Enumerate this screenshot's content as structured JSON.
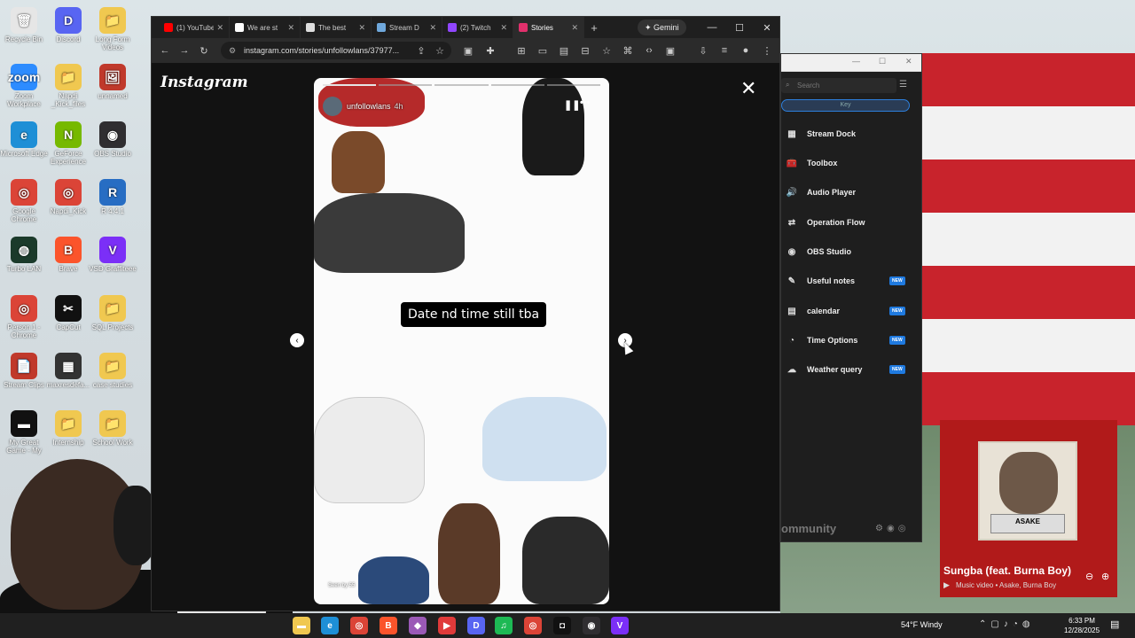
{
  "desktop": {
    "icons": [
      {
        "label": "Recycle Bin",
        "glyph": "🗑",
        "color": "#e6e6e6"
      },
      {
        "label": "Discord",
        "glyph": "D",
        "color": "#5865f2"
      },
      {
        "label": "Long Form Videos",
        "glyph": "📁",
        "color": "#f0c850"
      },
      {
        "label": "Zoom Workplace",
        "glyph": "zoom",
        "color": "#2d8cff"
      },
      {
        "label": "Napdi _Kick_files",
        "glyph": "📁",
        "color": "#f0c850"
      },
      {
        "label": "unnamed",
        "glyph": "🖼",
        "color": "#c0392b"
      },
      {
        "label": "Microsoft Edge",
        "glyph": "e",
        "color": "#1e8fd6"
      },
      {
        "label": "GeForce Experience",
        "glyph": "N",
        "color": "#76b900"
      },
      {
        "label": "OBS Studio",
        "glyph": "◉",
        "color": "#302e31"
      },
      {
        "label": "Google Chrome",
        "glyph": "◎",
        "color": "#db4437"
      },
      {
        "label": "Napdi_Kick",
        "glyph": "◎",
        "color": "#db4437"
      },
      {
        "label": "R 4.4.1",
        "glyph": "R",
        "color": "#276dc3"
      },
      {
        "label": "Turbo LAN",
        "glyph": "◍",
        "color": "#1b3a2a"
      },
      {
        "label": "Brave",
        "glyph": "B",
        "color": "#fb542b"
      },
      {
        "label": "VSD Graffiteee",
        "glyph": "V",
        "color": "#7b2ff7"
      },
      {
        "label": "Person 1 - Chrome",
        "glyph": "◎",
        "color": "#db4437"
      },
      {
        "label": "CapCut",
        "glyph": "✂",
        "color": "#111111"
      },
      {
        "label": "SQL Projects",
        "glyph": "📁",
        "color": "#f0c850"
      },
      {
        "label": "Stream Clips",
        "glyph": "📄",
        "color": "#c0392b"
      },
      {
        "label": "maxresdefa...",
        "glyph": "▦",
        "color": "#333333"
      },
      {
        "label": "case studies",
        "glyph": "📁",
        "color": "#f0c850"
      },
      {
        "label": "My Great Game - My",
        "glyph": "▬",
        "color": "#111111"
      },
      {
        "label": "Internship",
        "glyph": "📁",
        "color": "#f0c850"
      },
      {
        "label": "School Work",
        "glyph": "📁",
        "color": "#f0c850"
      }
    ]
  },
  "browser": {
    "tabs": [
      {
        "label": "(1) YouTube",
        "color": "#ff0000"
      },
      {
        "label": "We are st",
        "color": "#ffffff"
      },
      {
        "label": "The best",
        "color": "#dddddd"
      },
      {
        "label": "Stream D",
        "color": "#6fa8dc"
      },
      {
        "label": "(2) Twitch",
        "color": "#9146ff"
      },
      {
        "label": "Stories",
        "color": "#e1306c"
      }
    ],
    "gemini_label": "Gemini",
    "url": "instagram.com/stories/unfollowlans/37977...",
    "controls": {
      "minimize": "—",
      "maximize": "☐",
      "close": "✕"
    }
  },
  "instagram": {
    "logo": "Instagram",
    "story": {
      "username": "unfollowlans",
      "time_ago": "4h",
      "caption": "Date nd time still tba",
      "seen_by": "Seen by 55",
      "progress_total": 5,
      "progress_current": 1
    },
    "close_icon": "✕"
  },
  "stream_dock": {
    "search_placeholder": "Search",
    "key_label": "Key",
    "items": [
      {
        "label": "Stream Dock",
        "icon": "▦",
        "new": false
      },
      {
        "label": "Toolbox",
        "icon": "🧰",
        "new": false
      },
      {
        "label": "Audio Player",
        "icon": "🔊",
        "new": false
      },
      {
        "label": "Operation Flow",
        "icon": "⇄",
        "new": false
      },
      {
        "label": "OBS Studio",
        "icon": "◉",
        "new": false
      },
      {
        "label": "Useful notes",
        "icon": "✎",
        "new": true
      },
      {
        "label": "calendar",
        "icon": "▤",
        "new": true
      },
      {
        "label": "Time Options",
        "icon": "◔",
        "new": true
      },
      {
        "label": "Weather query",
        "icon": "☁",
        "new": true
      }
    ],
    "new_badge": "NEW",
    "community": "ommunity"
  },
  "now_playing": {
    "title": "Sungba (feat. Burna Boy)",
    "subtitle": "Music video • Asake, Burna Boy",
    "album_plate": "ASAKE",
    "accent": "#b11a1a"
  },
  "taskbar": {
    "weather": "54°F  Windy",
    "time": "6:33 PM",
    "date": "12/28/2025"
  }
}
